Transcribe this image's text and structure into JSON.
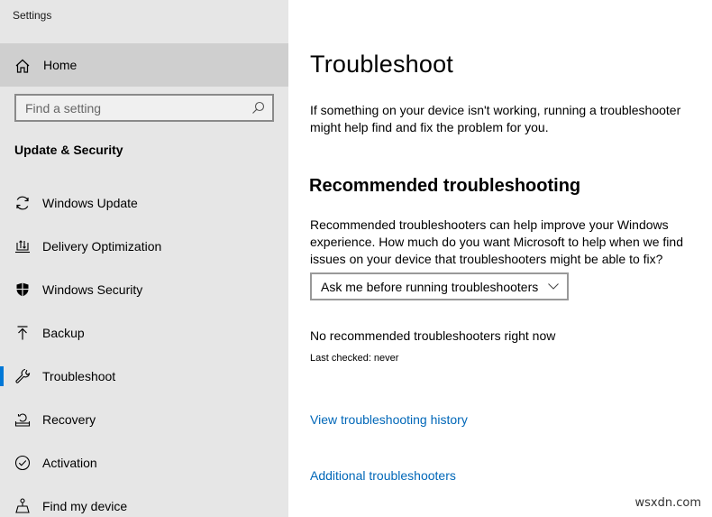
{
  "app": {
    "title": "Settings"
  },
  "sidebar": {
    "home_label": "Home",
    "search": {
      "placeholder": "Find a setting",
      "value": ""
    },
    "section_heading": "Update & Security",
    "items": [
      {
        "label": "Windows Update",
        "icon": "sync-icon",
        "selected": false
      },
      {
        "label": "Delivery Optimization",
        "icon": "delivery-optimization-icon",
        "selected": false
      },
      {
        "label": "Windows Security",
        "icon": "shield-icon",
        "selected": false
      },
      {
        "label": "Backup",
        "icon": "upload-arrow-icon",
        "selected": false
      },
      {
        "label": "Troubleshoot",
        "icon": "wrench-icon",
        "selected": true
      },
      {
        "label": "Recovery",
        "icon": "recovery-icon",
        "selected": false
      },
      {
        "label": "Activation",
        "icon": "check-circle-icon",
        "selected": false
      },
      {
        "label": "Find my device",
        "icon": "find-device-icon",
        "selected": false
      }
    ]
  },
  "main": {
    "title": "Troubleshoot",
    "intro": "If something on your device isn't working, running a troubleshooter might help find and fix the problem for you.",
    "recommended": {
      "heading": "Recommended troubleshooting",
      "description": "Recommended troubleshooters can help improve your Windows experience. How much do you want Microsoft to help when we find issues on your device that troubleshooters might be able to fix?",
      "dropdown_value": "Ask me before running troubleshooters",
      "status": "No recommended troubleshooters right now",
      "last_checked": "Last checked: never"
    },
    "links": {
      "history": "View troubleshooting history",
      "additional": "Additional troubleshooters"
    }
  },
  "watermark": "wsxdn.com",
  "colors": {
    "accent": "#0078d7",
    "link": "#0067b8",
    "sidebar_bg": "#e6e6e6",
    "home_bg": "#cfcfcf"
  }
}
